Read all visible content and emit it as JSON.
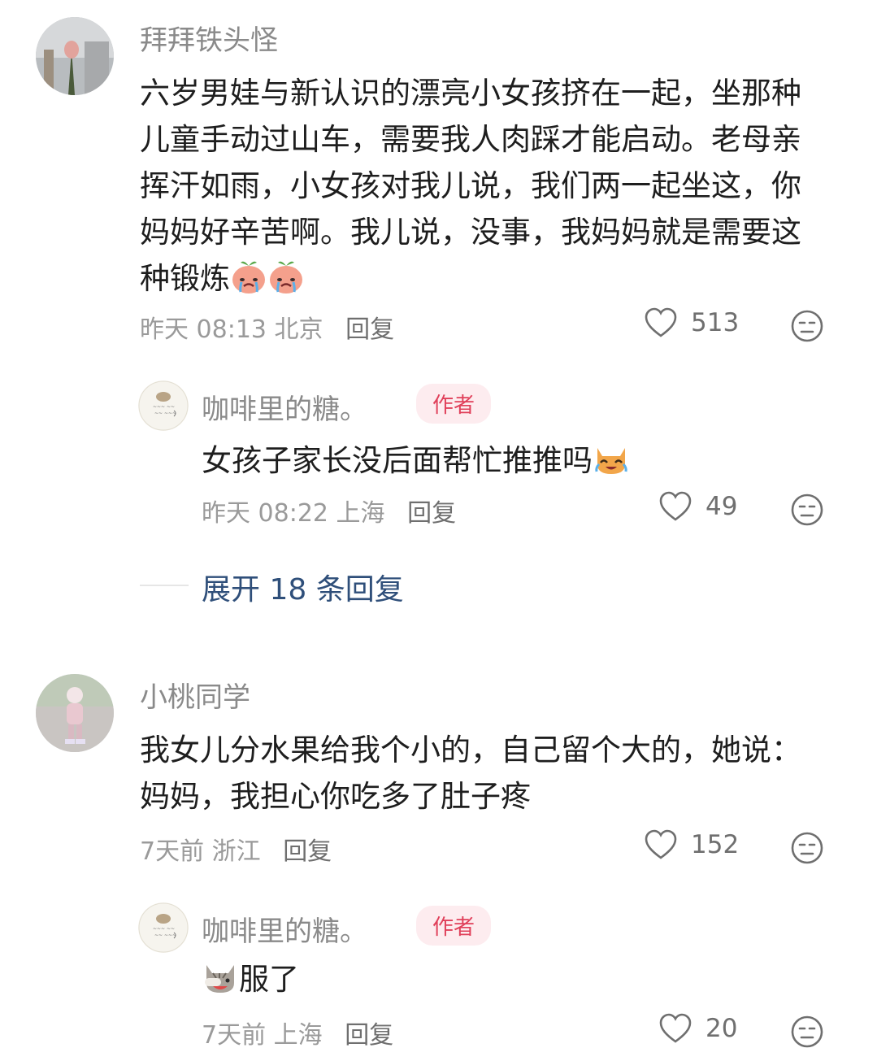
{
  "comments": [
    {
      "username": "拜拜铁头怪",
      "text": "六岁男娃与新认识的漂亮小女孩挤在一起，坐那种儿童手动过山车，需要我人肉踩才能启动。老母亲挥汗如雨，小女孩对我儿说，我们两一起坐这，你妈妈好辛苦啊。我儿说，没事，我妈妈就是需要这种锻炼",
      "emoji_after": [
        "crying-peach-emoji",
        "crying-peach-emoji"
      ],
      "time": "昨天 08:13",
      "location": "北京",
      "reply_label": "回复",
      "likes": "513",
      "reply": {
        "username": "咖啡里的糖。",
        "badge": "作者",
        "text": "女孩子家长没后面帮忙推推吗",
        "emoji_after": [
          "laughing-cat-emoji"
        ],
        "time": "昨天 08:22",
        "location": "上海",
        "reply_label": "回复",
        "likes": "49"
      },
      "expand_label": "展开 18 条回复"
    },
    {
      "username": "小桃同学",
      "text": "我女儿分水果给我个小的，自己留个大的，她说：妈妈，我担心你吃多了肚子疼",
      "time": "7天前",
      "location": "浙江",
      "reply_label": "回复",
      "likes": "152",
      "reply": {
        "username": "咖啡里的糖。",
        "badge": "作者",
        "text": "服了",
        "emoji_before": [
          "cat-facepalm-emoji"
        ],
        "time": "7天前",
        "location": "上海",
        "reply_label": "回复",
        "likes": "20"
      }
    }
  ],
  "colors": {
    "accent_link": "#2f4f7a",
    "badge_bg": "#fdecef",
    "badge_text": "#e0405a"
  }
}
